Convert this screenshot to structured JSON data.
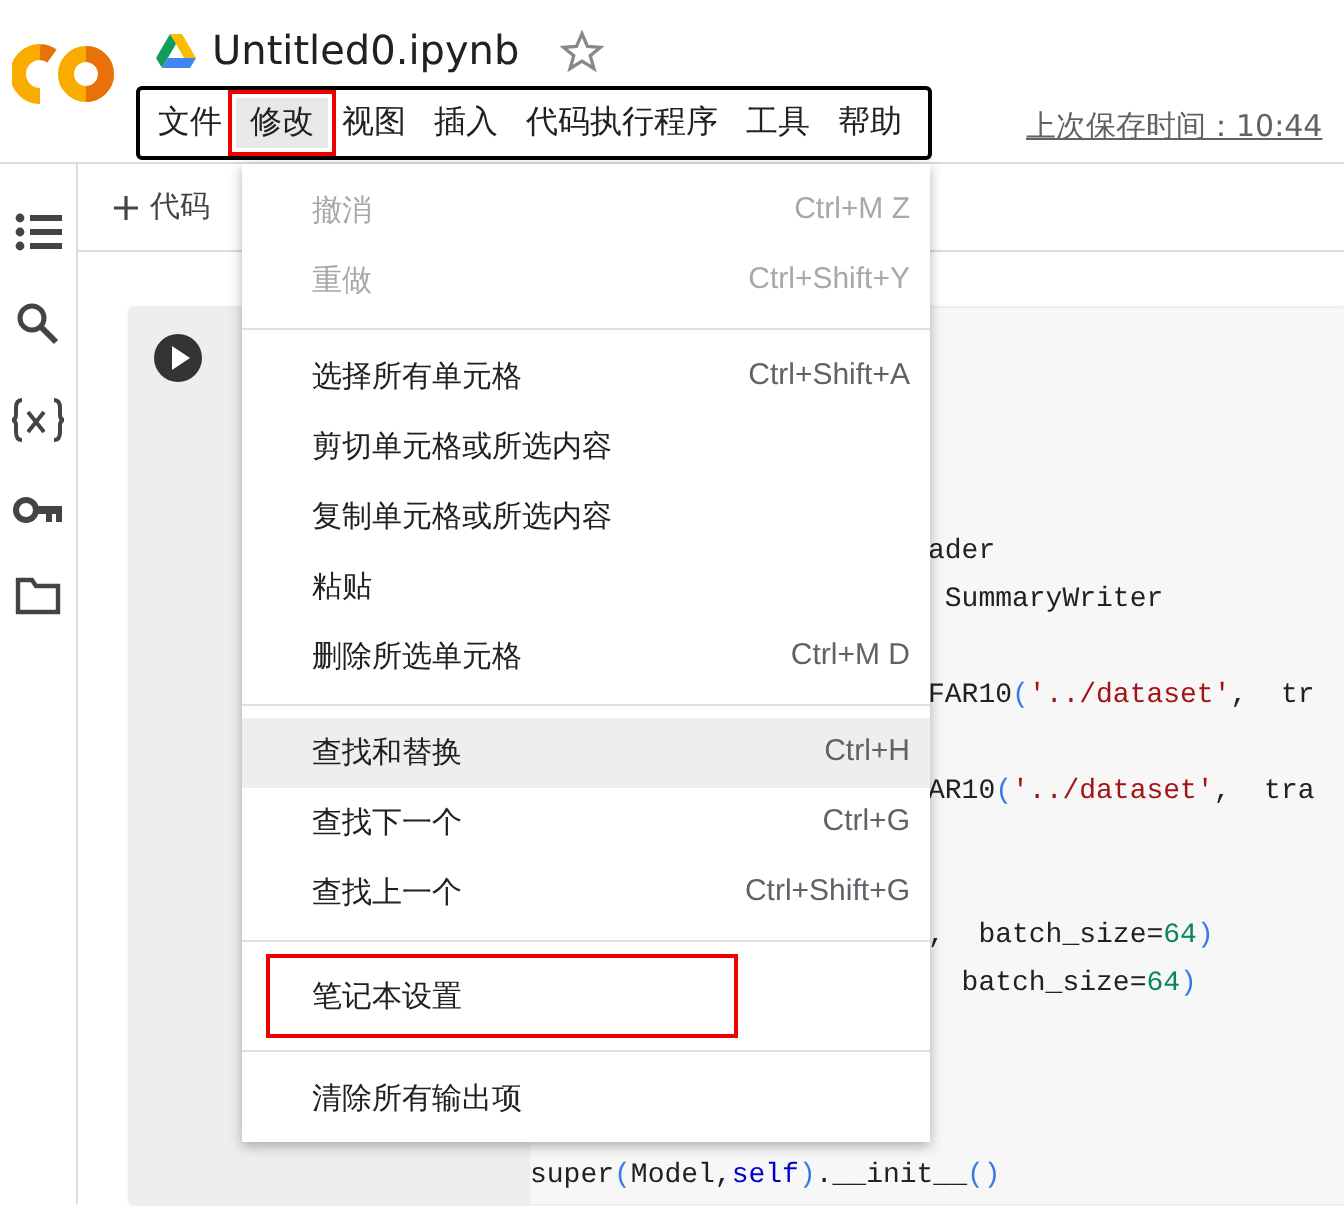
{
  "header": {
    "title": "Untitled0.ipynb",
    "starred": false,
    "last_saved": "上次保存时间：10:44"
  },
  "menubar": {
    "outlined": true,
    "items": [
      {
        "label": "文件",
        "selected": false,
        "annotated": false
      },
      {
        "label": "修改",
        "selected": true,
        "annotated": true
      },
      {
        "label": "视图",
        "selected": false,
        "annotated": false
      },
      {
        "label": "插入",
        "selected": false,
        "annotated": false
      },
      {
        "label": "代码执行程序",
        "selected": false,
        "annotated": false
      },
      {
        "label": "工具",
        "selected": false,
        "annotated": false
      },
      {
        "label": "帮助",
        "selected": false,
        "annotated": false
      }
    ]
  },
  "toolbar": {
    "add_code": "代码"
  },
  "code_lines": [
    {
      "clipped": true,
      "tokens": [
        {
          "kind": "plain",
          "text": "ader"
        }
      ]
    },
    {
      "clipped": true,
      "tokens": [
        {
          "kind": "plain",
          "text": " SummaryWriter"
        }
      ]
    },
    {
      "blank": true
    },
    {
      "clipped": true,
      "tokens": [
        {
          "kind": "plain",
          "text": "FAR10"
        },
        {
          "kind": "paren",
          "text": "("
        },
        {
          "kind": "string",
          "text": "'../dataset'"
        },
        {
          "kind": "plain",
          "text": ",  tr"
        }
      ]
    },
    {
      "blank": true
    },
    {
      "clipped": true,
      "tokens": [
        {
          "kind": "plain",
          "text": "AR10"
        },
        {
          "kind": "paren",
          "text": "("
        },
        {
          "kind": "string",
          "text": "'../dataset'"
        },
        {
          "kind": "plain",
          "text": ",  tra"
        }
      ]
    },
    {
      "blank": true
    },
    {
      "blank": true
    },
    {
      "clipped": true,
      "tokens": [
        {
          "kind": "plain",
          "text": ",  batch_size="
        },
        {
          "kind": "number",
          "text": "64"
        },
        {
          "kind": "paren",
          "text": ")"
        }
      ]
    },
    {
      "clipped": true,
      "tokens": [
        {
          "kind": "plain",
          "text": "  batch_size="
        },
        {
          "kind": "number",
          "text": "64"
        },
        {
          "kind": "paren",
          "text": ")"
        }
      ]
    },
    {
      "blank": true
    },
    {
      "blank": true
    },
    {
      "blank": true
    },
    {
      "clipped": false,
      "tokens": [
        {
          "kind": "plain",
          "text": "super"
        },
        {
          "kind": "paren",
          "text": "("
        },
        {
          "kind": "plain",
          "text": "Model,"
        },
        {
          "kind": "keyword",
          "text": "self"
        },
        {
          "kind": "paren",
          "text": ")"
        },
        {
          "kind": "plain",
          "text": ".__init__"
        },
        {
          "kind": "paren",
          "text": "()"
        }
      ]
    }
  ],
  "menu": {
    "items": [
      {
        "kind": "item",
        "label": "撤消",
        "shortcut": "Ctrl+M Z",
        "disabled": true,
        "selected": false,
        "annotated": false
      },
      {
        "kind": "item",
        "label": "重做",
        "shortcut": "Ctrl+Shift+Y",
        "disabled": true,
        "selected": false,
        "annotated": false
      },
      {
        "kind": "divider"
      },
      {
        "kind": "item",
        "label": "选择所有单元格",
        "shortcut": "Ctrl+Shift+A",
        "disabled": false,
        "selected": false,
        "annotated": false
      },
      {
        "kind": "item",
        "label": "剪切单元格或所选内容",
        "disabled": false,
        "selected": false,
        "annotated": false
      },
      {
        "kind": "item",
        "label": "复制单元格或所选内容",
        "disabled": false,
        "selected": false,
        "annotated": false
      },
      {
        "kind": "item",
        "label": "粘贴",
        "disabled": false,
        "selected": false,
        "annotated": false
      },
      {
        "kind": "item",
        "label": "删除所选单元格",
        "shortcut": "Ctrl+M D",
        "disabled": false,
        "selected": false,
        "annotated": false
      },
      {
        "kind": "divider"
      },
      {
        "kind": "item",
        "label": "查找和替换",
        "shortcut": "Ctrl+H",
        "disabled": false,
        "selected": true,
        "annotated": false
      },
      {
        "kind": "item",
        "label": "查找下一个",
        "shortcut": "Ctrl+G",
        "disabled": false,
        "selected": false,
        "annotated": false
      },
      {
        "kind": "item",
        "label": "查找上一个",
        "shortcut": "Ctrl+Shift+G",
        "disabled": false,
        "selected": false,
        "annotated": false
      },
      {
        "kind": "divider"
      },
      {
        "kind": "item",
        "label": "笔记本设置",
        "disabled": false,
        "selected": false,
        "annotated": true
      },
      {
        "kind": "divider"
      },
      {
        "kind": "item",
        "label": "清除所有输出项",
        "disabled": false,
        "selected": false,
        "annotated": false
      }
    ]
  }
}
